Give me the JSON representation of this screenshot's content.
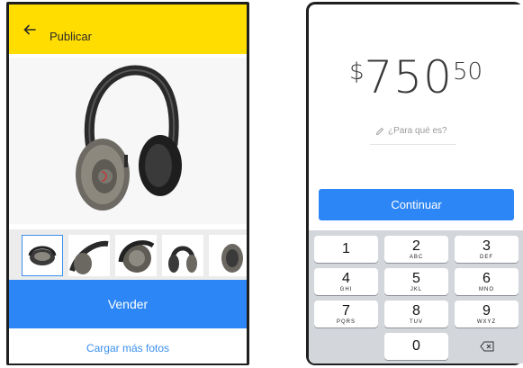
{
  "left_screen": {
    "header": {
      "title": "Publicar",
      "back_icon": "arrow-left-icon",
      "background": "#ffdd00"
    },
    "thumbnails_count": 5,
    "primary_button": {
      "label": "Vender",
      "color": "#2d86f5"
    },
    "secondary_link": {
      "label": "Cargar más fotos",
      "color": "#3a8ff0"
    }
  },
  "right_screen": {
    "amount": {
      "currency": "$",
      "integer": "750",
      "decimal": "50"
    },
    "description": {
      "placeholder": "¿Para qué es?",
      "icon": "pencil-icon"
    },
    "continue_button": {
      "label": "Continuar",
      "color": "#2d86f5"
    },
    "keypad": {
      "keys": [
        {
          "num": "1",
          "letters": ""
        },
        {
          "num": "2",
          "letters": "ABC"
        },
        {
          "num": "3",
          "letters": "DEF"
        },
        {
          "num": "4",
          "letters": "GHI"
        },
        {
          "num": "5",
          "letters": "JKL"
        },
        {
          "num": "6",
          "letters": "MNO"
        },
        {
          "num": "7",
          "letters": "PQRS"
        },
        {
          "num": "8",
          "letters": "TUV"
        },
        {
          "num": "9",
          "letters": "WXYZ"
        },
        {
          "num": "",
          "letters": ""
        },
        {
          "num": "0",
          "letters": ""
        },
        {
          "num": "",
          "letters": "",
          "icon": "backspace-icon"
        }
      ]
    }
  }
}
